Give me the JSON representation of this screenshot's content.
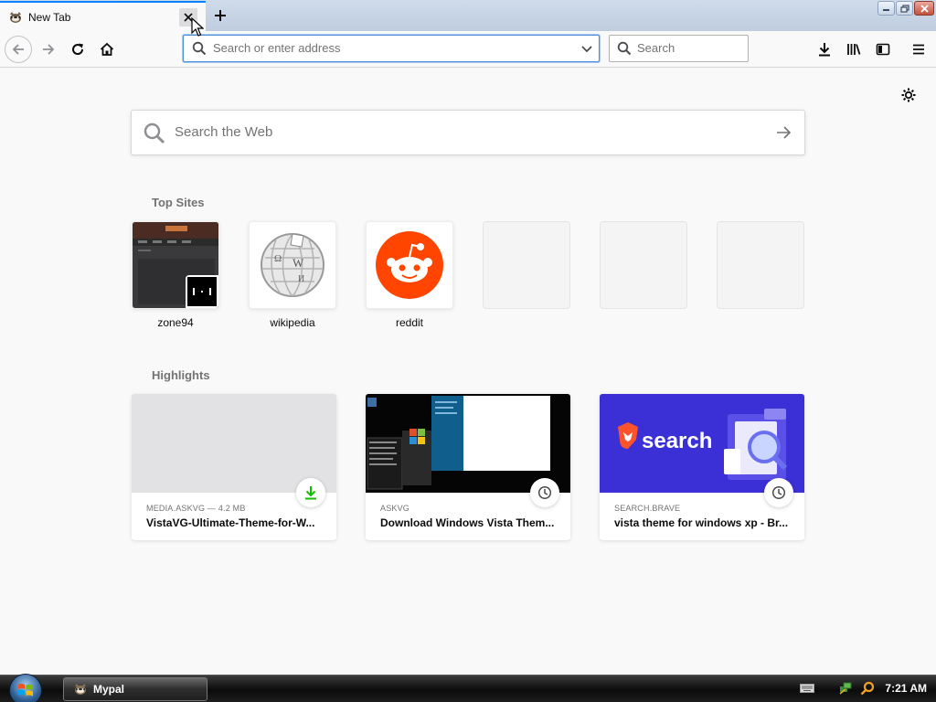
{
  "browser": {
    "tab": {
      "title": "New Tab",
      "favicon": "mypal-raccoon-icon",
      "close_icon": "close-icon"
    },
    "new_tab_icon": "plus-icon",
    "window_controls": [
      "minimize-icon",
      "restore-icon",
      "close-icon"
    ]
  },
  "toolbar": {
    "url_placeholder": "Search or enter address",
    "search_placeholder": "Search",
    "left_icons": [
      "back-arrow-icon",
      "forward-arrow-icon",
      "reload-icon",
      "home-icon"
    ],
    "right_icons": [
      "download-icon",
      "library-icon",
      "sidebar-icon",
      "hamburger-menu-icon"
    ]
  },
  "newtab": {
    "search_placeholder": "Search the Web",
    "top_sites_title": "Top Sites",
    "top_sites": [
      {
        "label": "zone94"
      },
      {
        "label": "wikipedia"
      },
      {
        "label": "reddit"
      }
    ],
    "highlights_title": "Highlights",
    "highlights": [
      {
        "source": "MEDIA.ASKVG — 4.2 MB",
        "title": "VistaVG-Ultimate-Theme-for-W...",
        "badge": "download-icon"
      },
      {
        "source": "ASKVG",
        "title": "Download Windows Vista Them...",
        "badge": "clock-icon"
      },
      {
        "source": "SEARCH.BRAVE",
        "title": "vista theme for windows xp - Br...",
        "badge": "clock-icon",
        "thumb_text": "search"
      }
    ]
  },
  "taskbar": {
    "app_label": "Mypal",
    "clock": "7:21 AM"
  },
  "colors": {
    "accent": "#0a84ff",
    "reddit": "#ff4500",
    "brave_bg": "#3b2fd6",
    "download_green": "#12bc00"
  }
}
